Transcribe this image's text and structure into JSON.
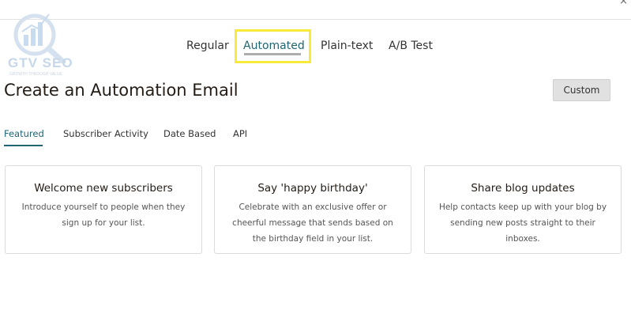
{
  "watermark": {
    "text": "GTV SEO",
    "subtext": "GROWTH THROUGH VALUE"
  },
  "type_tabs": [
    {
      "label": "Regular",
      "active": false
    },
    {
      "label": "Automated",
      "active": true
    },
    {
      "label": "Plain-text",
      "active": false
    },
    {
      "label": "A/B Test",
      "active": false
    }
  ],
  "page_title": "Create an Automation Email",
  "custom_button_label": "Custom",
  "category_tabs": [
    {
      "label": "Featured",
      "active": true
    },
    {
      "label": "Subscriber Activity",
      "active": false
    },
    {
      "label": "Date Based",
      "active": false
    },
    {
      "label": "API",
      "active": false
    }
  ],
  "cards": [
    {
      "title": "Welcome new subscribers",
      "description": "Introduce yourself to people when they sign up for your list."
    },
    {
      "title": "Say 'happy birthday'",
      "description": "Celebrate with an exclusive offer or cheerful message that sends based on the birthday field in your list."
    },
    {
      "title": "Share blog updates",
      "description": "Help contacts keep up with your blog by sending new posts straight to their inboxes."
    }
  ],
  "colors": {
    "accent": "#1e6673",
    "highlight": "#f7ea3a"
  }
}
